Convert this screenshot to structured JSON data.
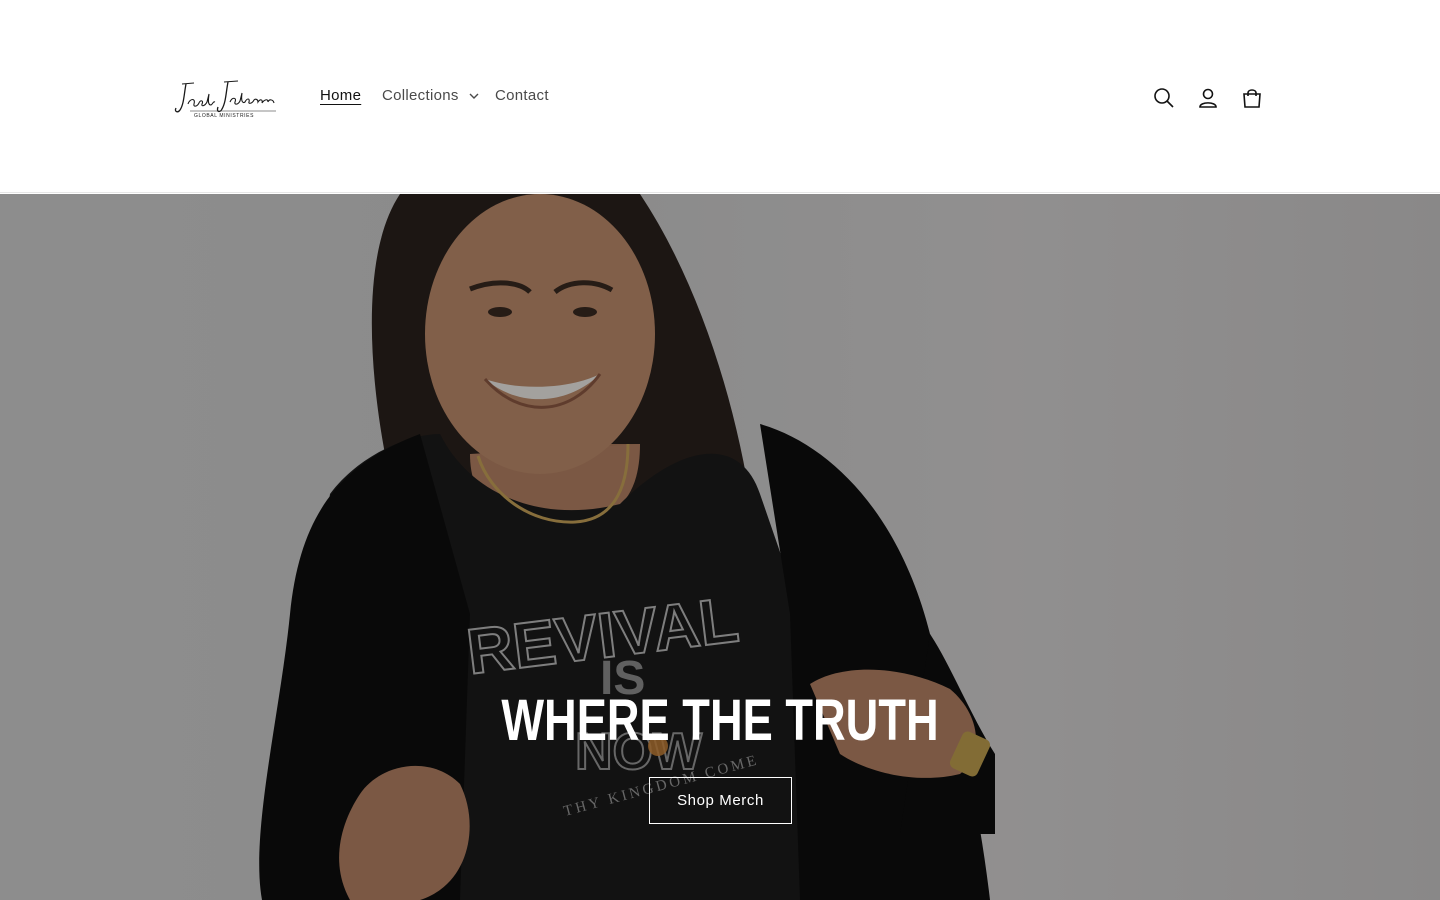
{
  "brand": {
    "logo_name": "Jack Johnson",
    "logo_subtitle": "GLOBAL MINISTRIES"
  },
  "nav": {
    "items": [
      {
        "label": "Home",
        "active": true
      },
      {
        "label": "Collections",
        "has_dropdown": true
      },
      {
        "label": "Contact"
      }
    ]
  },
  "header_icons": {
    "search": "search-icon",
    "account": "account-icon",
    "cart": "cart-icon"
  },
  "hero": {
    "heading": "WHERE THE TRUTH",
    "button_label": "Shop Merch",
    "shirt_text": {
      "line1": "REVIVAL",
      "line2": "IS",
      "line3": "NOW",
      "line4": "THY KINGDOM COME"
    }
  },
  "colors": {
    "text": "#121212",
    "nav_text": "#4a4a4a",
    "hero_overlay": "rgba(0,0,0,0.33)",
    "button_border": "#ffffff"
  }
}
